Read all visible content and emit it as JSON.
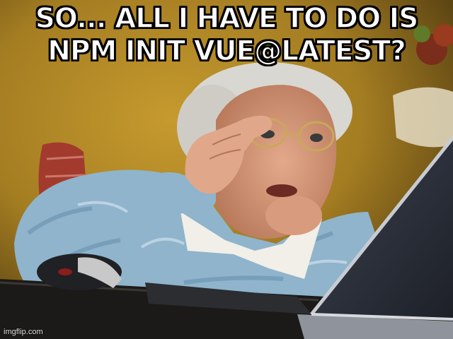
{
  "caption": {
    "line1": "SO... ALL I HAVE TO DO IS",
    "line2": "NPM INIT VUE@LATEST?"
  },
  "watermark": "imgflip.com",
  "colors": {
    "wall": "#b48a24",
    "sweater": "#8fb4cc",
    "laptop": "#2a2e36",
    "caption_fill": "#ffffff",
    "caption_outline": "#000000"
  }
}
